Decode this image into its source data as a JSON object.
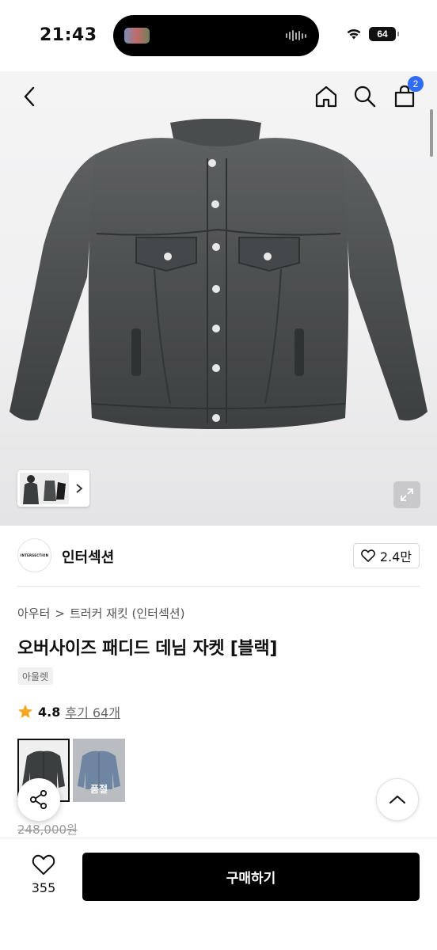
{
  "status_bar": {
    "time": "21:43",
    "battery": "64"
  },
  "nav": {
    "cart_count": "2"
  },
  "brand": {
    "logo_text": "INTERSECTION",
    "name": "인터섹션",
    "likes": "2.4만"
  },
  "breadcrumb": {
    "category": "아우터",
    "separator": ">",
    "subcategory": "트러커 재킷 (인터섹션)"
  },
  "product": {
    "title": "오버사이즈 패디드 데님 자켓 [블랙]",
    "tag": "아울렛",
    "rating": "4.8",
    "review_link": "후기 64개",
    "original_price": "248,000원"
  },
  "options": [
    {
      "name": "black",
      "selected": true,
      "soldout_label": ""
    },
    {
      "name": "blue",
      "selected": false,
      "soldout_label": "품절"
    }
  ],
  "bottom_bar": {
    "wish_count": "355",
    "buy_label": "구매하기"
  },
  "colors": {
    "accent_badge": "#2f6bf5",
    "buy_button": "#000000",
    "star": "#f5a623"
  },
  "icons": [
    "back-arrow-icon",
    "home-icon",
    "search-icon",
    "cart-icon",
    "chevron-right-icon",
    "expand-icon",
    "heart-icon",
    "star-icon",
    "share-icon",
    "chevron-up-icon",
    "wifi-icon"
  ]
}
